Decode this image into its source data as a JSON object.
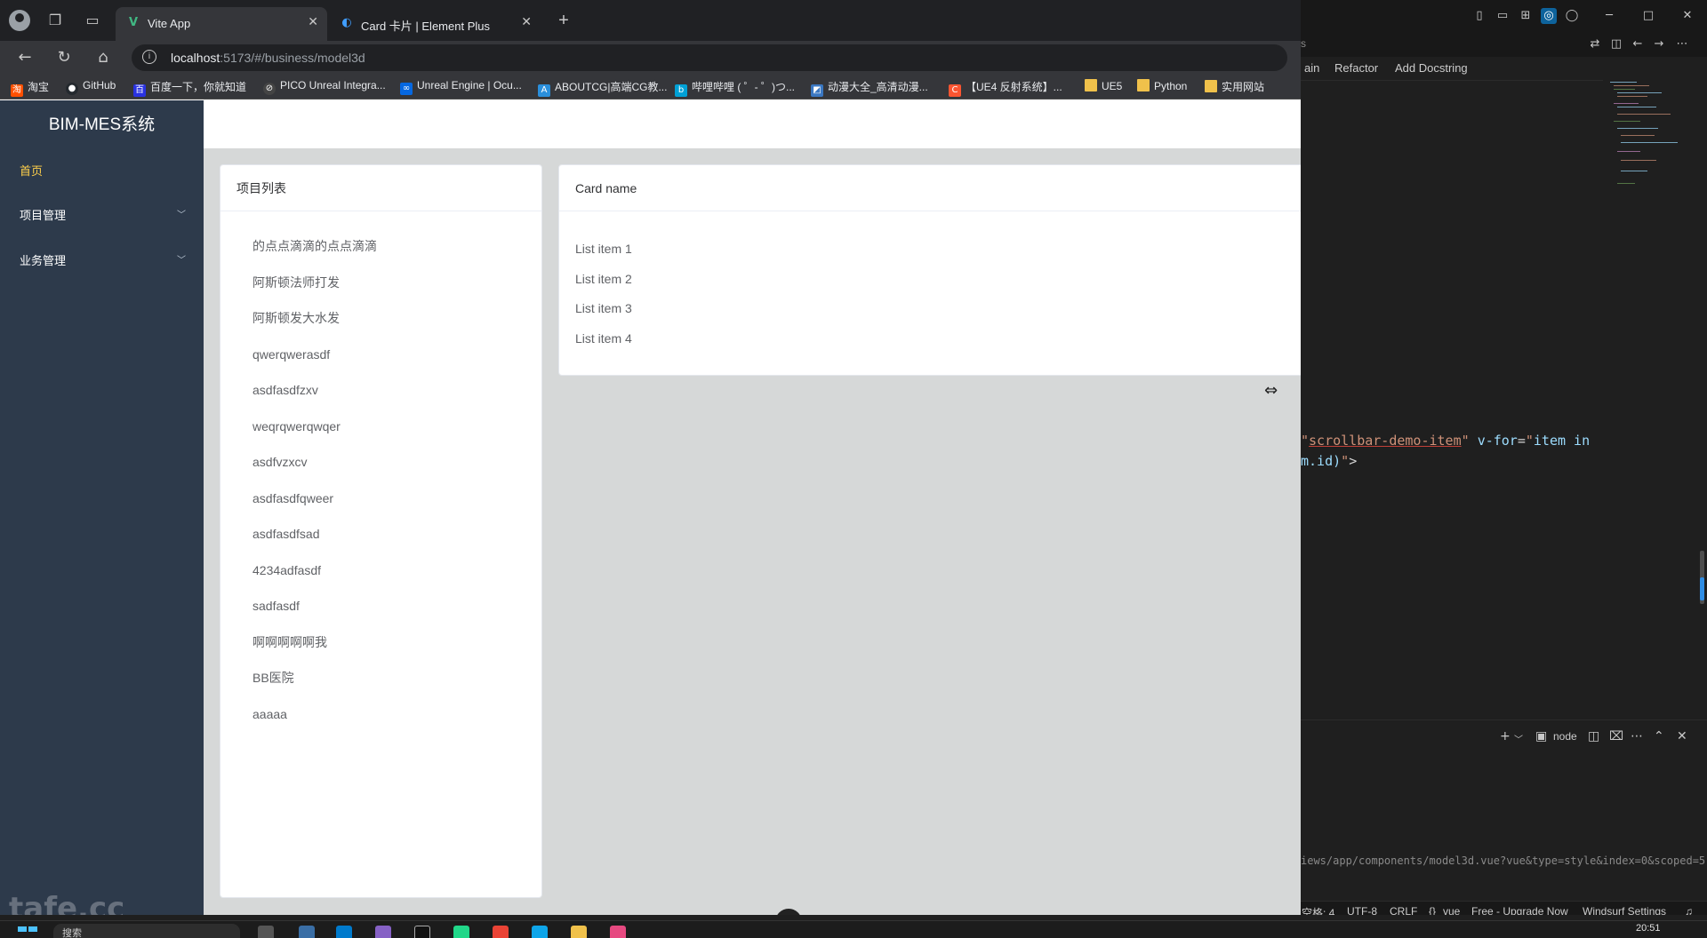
{
  "browser": {
    "tabs": [
      {
        "title": "Vite App",
        "favicon": "vue-logo-icon",
        "active": true
      },
      {
        "title": "Card 卡片 | Element Plus",
        "favicon": "element-plus-icon",
        "active": false
      }
    ],
    "address": {
      "host": "localhost",
      "path": ":5173/#/business/model3d"
    },
    "bookmarks": [
      {
        "label": "淘宝",
        "icon": "taobao-icon",
        "color": "#ff5000"
      },
      {
        "label": "GitHub",
        "icon": "github-icon",
        "color": "#24292e"
      },
      {
        "label": "百度一下，你就知道",
        "icon": "baidu-icon",
        "color": "#2932e1"
      },
      {
        "label": "PICO Unreal Integra...",
        "icon": "pico-icon",
        "color": "#444444"
      },
      {
        "label": "Unreal Engine | Ocu...",
        "icon": "meta-icon",
        "color": "#0668e1"
      },
      {
        "label": "ABOUTCG|高端CG教...",
        "icon": "aboutcg-icon",
        "color": "#2a8fdc"
      },
      {
        "label": "哔哩哔哩 ( ゜- ゜)つ...",
        "icon": "bilibili-icon",
        "color": "#00a1d6"
      },
      {
        "label": "动漫大全_高清动漫...",
        "icon": "anime-icon",
        "color": "#3a77c2"
      },
      {
        "label": "【UE4 反射系统】...",
        "icon": "csdn-icon",
        "color": "#fc5531"
      },
      {
        "label": "UE5",
        "icon": "folder-icon"
      },
      {
        "label": "Python",
        "icon": "folder-icon"
      },
      {
        "label": "实用网站",
        "icon": "folder-icon"
      }
    ]
  },
  "app": {
    "logo": "BIM-MES系统",
    "menu": [
      {
        "label": "首页",
        "active": true,
        "expandable": false
      },
      {
        "label": "项目管理",
        "active": false,
        "expandable": true
      },
      {
        "label": "业务管理",
        "active": false,
        "expandable": true
      }
    ],
    "project_card": {
      "header": "项目列表",
      "items": [
        "的点点滴滴的点点滴滴",
        "阿斯顿法师打发",
        "阿斯顿发大水发",
        "qwerqwerasdf",
        "asdfasdfzxv",
        "weqrqwerqwqer",
        "asdfvzxcv",
        "asdfasdfqweer",
        "asdfasdfsad",
        "4234adfasdf",
        "sadfasdf",
        "啊啊啊啊啊我",
        "BB医院",
        "aaaaa"
      ]
    },
    "detail_card": {
      "header": "Card name",
      "items": [
        "List item 1",
        "List item 2",
        "List item 3",
        "List item 4"
      ]
    },
    "colors": {
      "sidebar_bg": "#2d3a4b",
      "menu_active": "#ffd04b",
      "content_bg": "#d6d8d8"
    }
  },
  "ide": {
    "codelens": {
      "partial": "ain",
      "refactor": "Refactor",
      "docstring": "Add Docstring"
    },
    "sidebar_partial": "s",
    "code": {
      "line1_class": "scrollbar-demo-item",
      "line1_attr": "v-for",
      "line1_value_start": "item in",
      "line2_tail": "m.id)"
    },
    "terminal": {
      "shell": "node"
    },
    "path": "iews/app/components/model3d.vue?vue&type=style&index=0&scoped=5",
    "statusbar": {
      "indent": "空格: 4",
      "encoding": "UTF-8",
      "eol": "CRLF",
      "language": "vue",
      "plan": "Free - Upgrade Now",
      "settings": "Windsurf Settings"
    }
  },
  "taskbar": {
    "search_placeholder": "搜索",
    "clock": "20:51"
  },
  "watermark": "tafe.cc"
}
